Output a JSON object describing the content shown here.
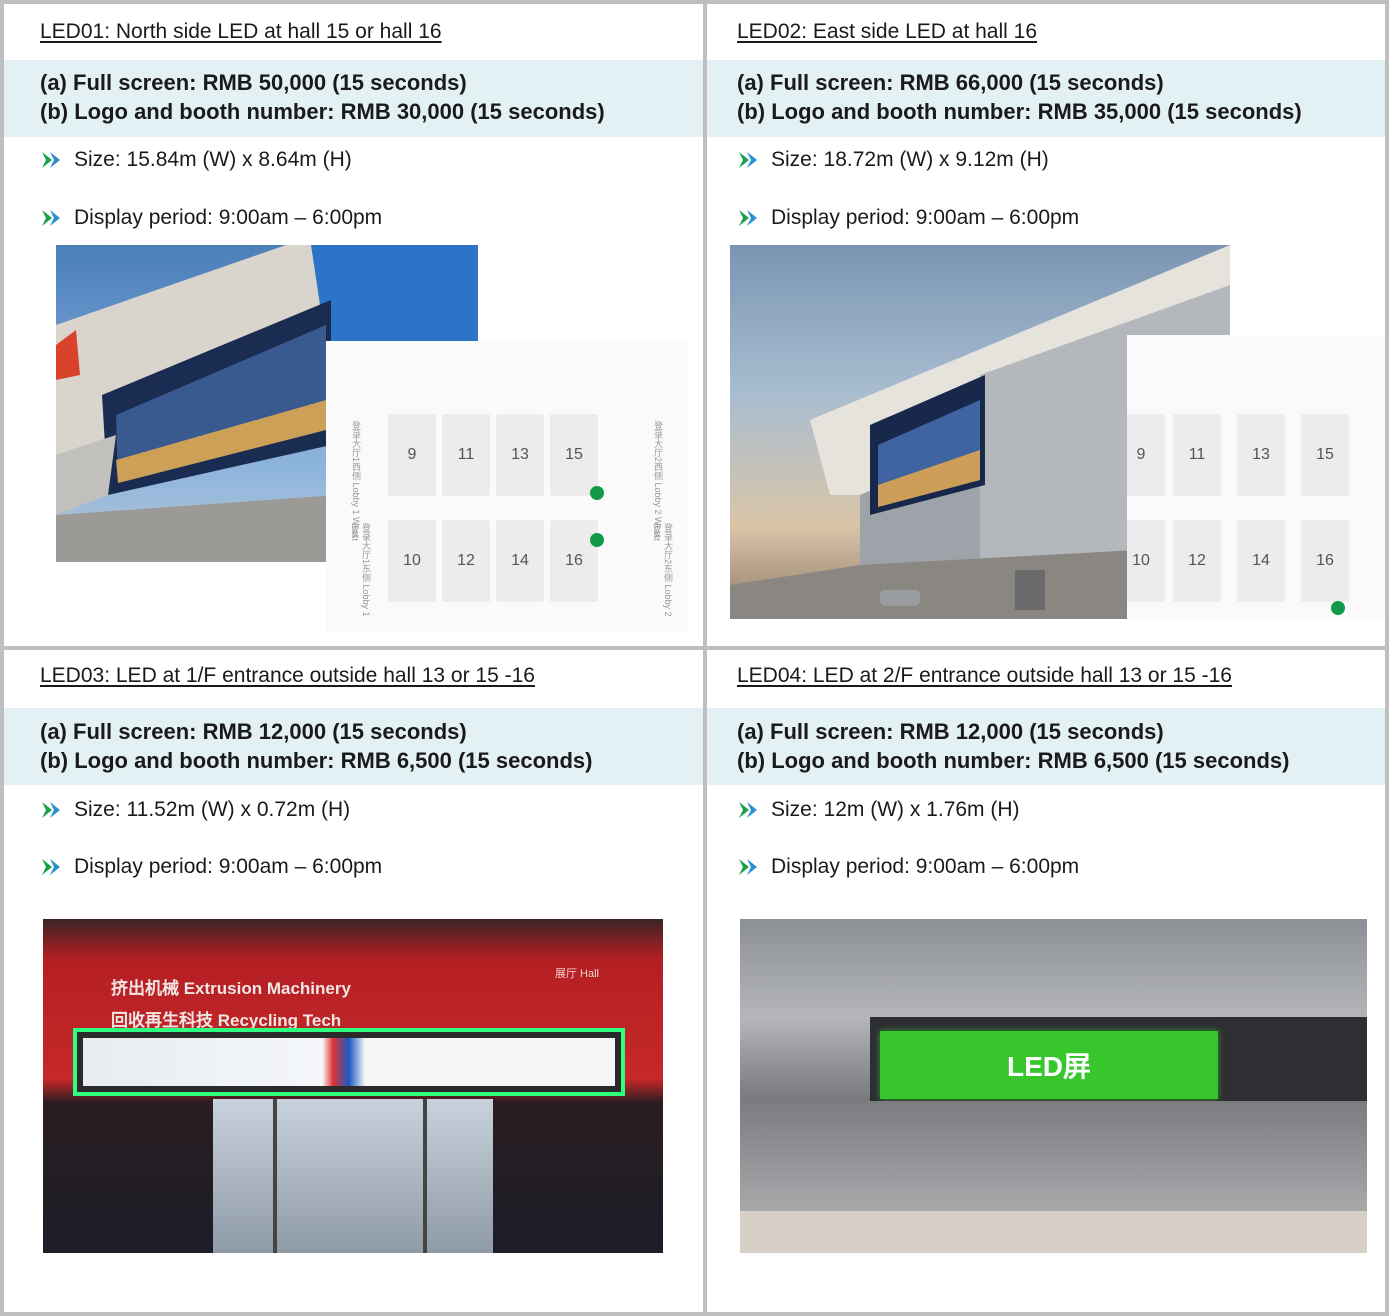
{
  "cells": [
    {
      "title": "LED01: North side LED at hall 15 or hall 16",
      "price_a": "(a) Full screen: RMB 50,000 (15 seconds)",
      "price_b": "(b) Logo and booth number: RMB 30,000 (15 seconds)",
      "size": "Size: 15.84m (W) x 8.64m (H)",
      "period": "Display period: 9:00am – 6:00pm",
      "map": {
        "halls_top": [
          "9",
          "11",
          "13",
          "15"
        ],
        "halls_bottom": [
          "10",
          "12",
          "14",
          "16"
        ],
        "lobby_1": "登录大厅1西侧 Lobby 1 West",
        "lobby_2": "登录大厅1东侧 Lobby 1 East",
        "lobby_3": "登录大厅2西侧 Lobby 2 West",
        "lobby_4": "登录大厅2东侧 Lobby 2 East"
      }
    },
    {
      "title": "LED02: East side LED at hall 16",
      "price_a": "(a) Full screen: RMB 66,000 (15 seconds)",
      "price_b": "(b) Logo and booth number: RMB 35,000 (15 seconds)",
      "size": "Size: 18.72m (W) x 9.12m (H)",
      "period": "Display period: 9:00am – 6:00pm",
      "map": {
        "halls_top": [
          "9",
          "11",
          "13",
          "15"
        ],
        "halls_bottom": [
          "10",
          "12",
          "14",
          "16"
        ]
      }
    },
    {
      "title": "LED03: LED at 1/F entrance outside hall 13 or 15 -16",
      "price_a": "(a) Full screen: RMB 12,000 (15 seconds)",
      "price_b": "(b) Logo and booth number: RMB 6,500 (15 seconds)",
      "size": "Size: 11.52m (W) x 0.72m (H)",
      "period": "Display period: 9:00am – 6:00pm",
      "photo": {
        "line1": "挤出机械 Extrusion Machinery",
        "line2": "回收再生科技 Recycling Tech",
        "hall_tag": "展厅 Hall"
      }
    },
    {
      "title": "LED04: LED at 2/F entrance outside hall 13 or 15 -16",
      "price_a": "(a) Full screen: RMB 12,000 (15 seconds)",
      "price_b": "(b) Logo and booth number: RMB 6,500 (15 seconds)",
      "size": "Size: 12m (W) x 1.76m (H)",
      "period": "Display period: 9:00am – 6:00pm",
      "photo": {
        "led_label": "LED屏"
      }
    }
  ],
  "colors": {
    "grid_border": "#bfbfbf",
    "price_band": "#e4f1f4",
    "bullet_green": "#1aa04a",
    "bullet_blue": "#2a8fd0",
    "location_dot": "#129a48"
  },
  "icons": {
    "bullet": "double-chevron-right-icon"
  }
}
